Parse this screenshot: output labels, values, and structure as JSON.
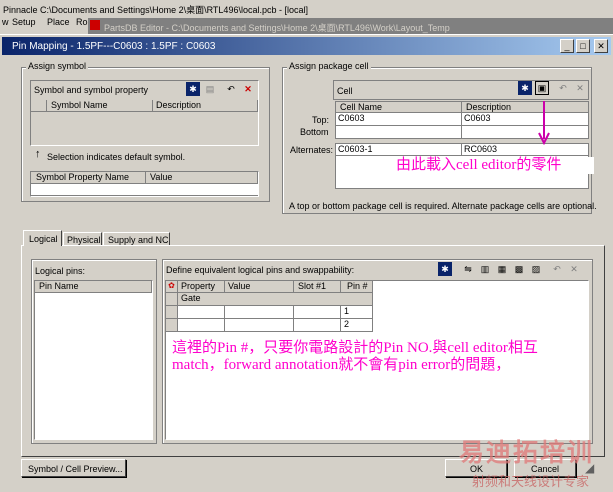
{
  "colors": {
    "titlebar": "#0a246a",
    "annotation": "#ff00cc",
    "arrow": "#cc00aa"
  },
  "bg_app": {
    "title_text": "Pinnacle  C:\\Documents and Settings\\Home 2\\桌面\\RTL496\\local.pcb - [local]",
    "menu": [
      "w",
      "Setup",
      "Place",
      "Ro"
    ]
  },
  "partsdb": {
    "title": "PartsDB Editor - C:\\Documents and Settings\\Home 2\\桌面\\RTL496\\Work\\Layout_Temp"
  },
  "dialog": {
    "title": "Pin Mapping - 1.5PF---C0603 : 1.5PF : C0603",
    "controls": {
      "min": "_",
      "max": "□",
      "close": "✕"
    }
  },
  "assign_symbol": {
    "title": "Assign symbol",
    "grid_title": "Symbol and symbol property",
    "columns": [
      "Symbol Name",
      "Description"
    ],
    "hint": "Selection indicates default symbol.",
    "prop_columns": [
      "Symbol Property Name",
      "Value"
    ]
  },
  "assign_package": {
    "title": "Assign package cell",
    "cell_label": "Cell",
    "columns": [
      "Cell Name",
      "Description"
    ],
    "top_label": "Top:",
    "bottom_label": "Bottom",
    "top_name": "C0603",
    "top_desc": "C0603",
    "alternates_label": "Alternates:",
    "alt_name": "C0603-1",
    "alt_desc": "RC0603",
    "note": "A top or bottom package cell is required.  Alternate package cells are optional."
  },
  "annotation1": "由此載入cell editor的零件",
  "tabs": [
    "Logical",
    "Physical",
    "Supply and NC"
  ],
  "logical": {
    "pins_label": "Logical pins:",
    "pin_column": "Pin Name",
    "define_label": "Define equivalent logical pins and swappability:",
    "columns": [
      "Property",
      "Value",
      "Slot #1",
      "Pin #"
    ],
    "gate_label": "Gate",
    "pin_values": [
      "1",
      "2"
    ]
  },
  "annotation2": "這裡的Pin #，只要你電路設計的Pin NO.與cell editor相互match，forward annotation就不會有pin error的問題，",
  "buttons": {
    "preview": "Symbol / Cell Preview...",
    "ok": "OK",
    "cancel": "Cancel"
  },
  "watermark": {
    "line1": "易迪拓培训",
    "line2": "射频和天线设计专家"
  }
}
